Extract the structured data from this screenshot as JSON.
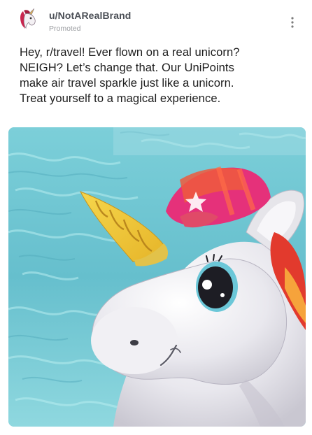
{
  "post": {
    "author": "u/NotARealBrand",
    "promoted_label": "Promoted",
    "body_lines": [
      "Hey, r/travel! Ever flown on a real unicorn?",
      "NEIGH? Let’s change that. Our UniPoints",
      "make air travel sparkle just like a unicorn.",
      "Treat yourself to a magical experience."
    ],
    "avatar_icon": "unicorn-logo-icon",
    "more_icon": "vertical-dots-icon",
    "image_subject": "inflatable-unicorn-pool-float"
  },
  "colors": {
    "author_text": "#4b4f56",
    "promoted_text": "#9a9ca0",
    "body_text": "#1c1c1c",
    "pool_water": "#6fc3d0",
    "unicorn_body": "#ecebef",
    "horn": "#f3cf3e",
    "mane_pink": "#e5317a",
    "mane_red": "#e9372b"
  }
}
